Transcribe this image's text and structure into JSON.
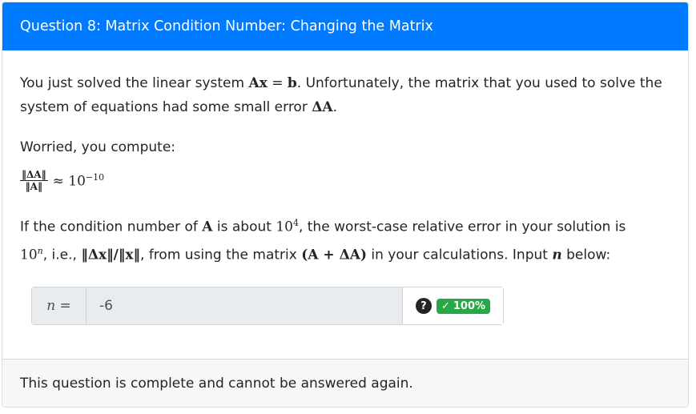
{
  "header": {
    "title": "Question 8: Matrix Condition Number: Changing the Matrix"
  },
  "body": {
    "p1_a": "You just solved the linear system ",
    "p1_eq_A": "A",
    "p1_eq_x": "x",
    "p1_eq_eq": " = ",
    "p1_eq_b": "b",
    "p1_b": ". Unfortunately, the matrix that you used to solve the system of equations had some small error ",
    "p1_delta": "ΔA",
    "p1_end": ".",
    "p2": "Worried, you compute:",
    "frac_num": "‖ΔA‖",
    "frac_den": "‖A‖",
    "approx": "≈ 10",
    "approx_exp": "−10",
    "p3_a": "If the condition number of ",
    "p3_A": "A",
    "p3_b": " is about ",
    "p3_ten": "10",
    "p3_exp": "4",
    "p3_c": ", the worst-case relative error in your solution is",
    "p4_ten": "10",
    "p4_exp": "n",
    "p4_a": ", i.e., ",
    "p4_norm": "‖Δx‖/‖x‖",
    "p4_b": ", from using the matrix ",
    "p4_mat": "(A + ΔA)",
    "p4_c": " in your calculations. Input ",
    "p4_n": "n",
    "p4_d": " below:"
  },
  "answer": {
    "prefix": "n =",
    "value": "-6",
    "help_icon": "question-circle-icon",
    "badge_check": "✓",
    "badge_text": "100%",
    "badge_color": "#28a745"
  },
  "footer": {
    "text": "This question is complete and cannot be answered again."
  }
}
